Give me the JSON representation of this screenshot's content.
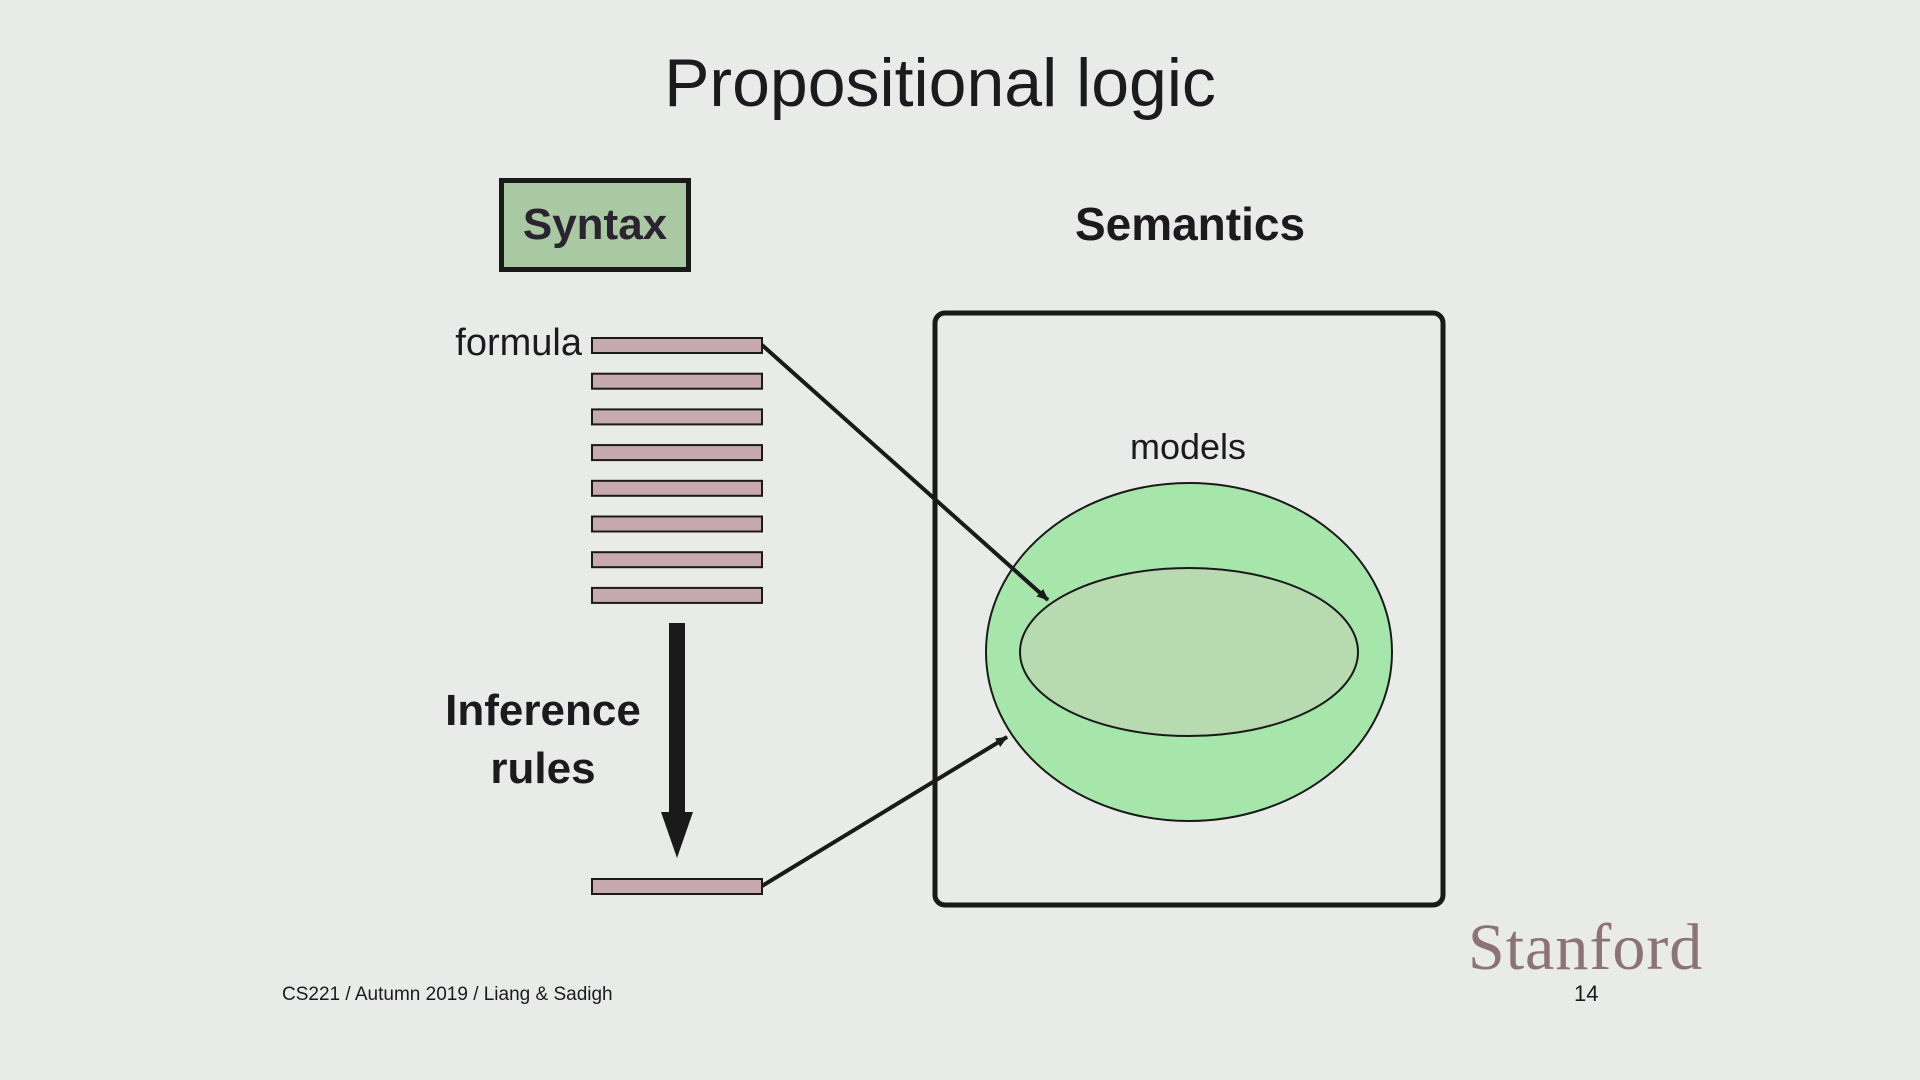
{
  "slide": {
    "title": "Propositional logic",
    "footer": "CS221 / Autumn 2019 / Liang & Sadigh",
    "page_number": "14",
    "logo_text": "Stanford"
  },
  "syntax": {
    "heading": "Syntax",
    "formula_label": "formula",
    "inference_label_line1": "Inference",
    "inference_label_line2": "rules",
    "formula_bar_count": 8
  },
  "semantics": {
    "heading": "Semantics",
    "models_label": "models"
  },
  "colors": {
    "background": "#e9ebe8",
    "syntax_box_fill": "#a9c9a3",
    "formula_bar_fill": "#c7a9b1",
    "outer_ellipse_fill": "#a6e6ab",
    "inner_ellipse_fill": "#b7dab0",
    "logo": "#8c7378",
    "stroke": "#1a1a1a"
  }
}
